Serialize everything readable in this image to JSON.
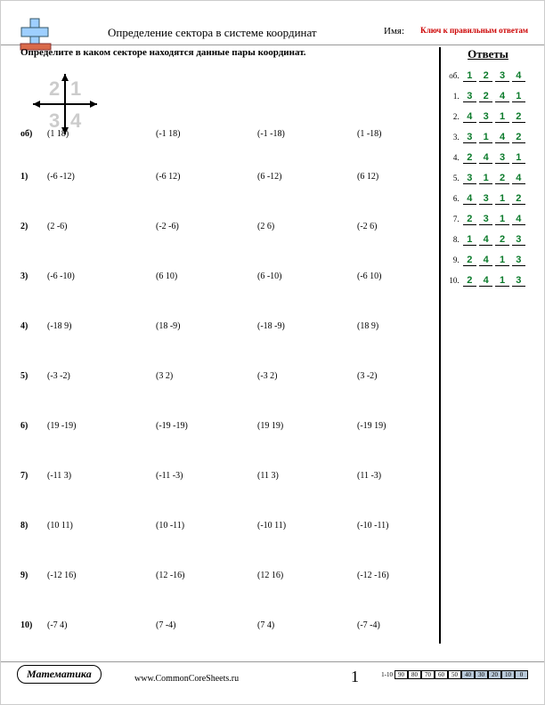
{
  "header": {
    "title": "Определение сектора в системе координат",
    "name_label": "Имя:",
    "key_label": "Ключ к правильным ответам"
  },
  "instruction": "Определите в каком секторе находятся данные пары координат.",
  "quadrants": {
    "q1": "1",
    "q2": "2",
    "q3": "3",
    "q4": "4"
  },
  "rows": [
    {
      "label": "об)",
      "pairs": [
        "(1 18)",
        "(-1 18)",
        "(-1 -18)",
        "(1 -18)"
      ]
    },
    {
      "label": "1)",
      "pairs": [
        "(-6 -12)",
        "(-6 12)",
        "(6 -12)",
        "(6 12)"
      ]
    },
    {
      "label": "2)",
      "pairs": [
        "(2 -6)",
        "(-2 -6)",
        "(2 6)",
        "(-2 6)"
      ]
    },
    {
      "label": "3)",
      "pairs": [
        "(-6 -10)",
        "(6 10)",
        "(6 -10)",
        "(-6 10)"
      ]
    },
    {
      "label": "4)",
      "pairs": [
        "(-18 9)",
        "(18 -9)",
        "(-18 -9)",
        "(18 9)"
      ]
    },
    {
      "label": "5)",
      "pairs": [
        "(-3 -2)",
        "(3 2)",
        "(-3 2)",
        "(3 -2)"
      ]
    },
    {
      "label": "6)",
      "pairs": [
        "(19 -19)",
        "(-19 -19)",
        "(19 19)",
        "(-19 19)"
      ]
    },
    {
      "label": "7)",
      "pairs": [
        "(-11 3)",
        "(-11 -3)",
        "(11 3)",
        "(11 -3)"
      ]
    },
    {
      "label": "8)",
      "pairs": [
        "(10 11)",
        "(10 -11)",
        "(-10 11)",
        "(-10 -11)"
      ]
    },
    {
      "label": "9)",
      "pairs": [
        "(-12 16)",
        "(12 -16)",
        "(12 16)",
        "(-12 -16)"
      ]
    },
    {
      "label": "10)",
      "pairs": [
        "(-7 4)",
        "(7 -4)",
        "(7 4)",
        "(-7 -4)"
      ]
    }
  ],
  "sidebar": {
    "title": "Ответы",
    "rows": [
      {
        "num": "об.",
        "vals": [
          "1",
          "2",
          "3",
          "4"
        ]
      },
      {
        "num": "1.",
        "vals": [
          "3",
          "2",
          "4",
          "1"
        ]
      },
      {
        "num": "2.",
        "vals": [
          "4",
          "3",
          "1",
          "2"
        ]
      },
      {
        "num": "3.",
        "vals": [
          "3",
          "1",
          "4",
          "2"
        ]
      },
      {
        "num": "4.",
        "vals": [
          "2",
          "4",
          "3",
          "1"
        ]
      },
      {
        "num": "5.",
        "vals": [
          "3",
          "1",
          "2",
          "4"
        ]
      },
      {
        "num": "6.",
        "vals": [
          "4",
          "3",
          "1",
          "2"
        ]
      },
      {
        "num": "7.",
        "vals": [
          "2",
          "3",
          "1",
          "4"
        ]
      },
      {
        "num": "8.",
        "vals": [
          "1",
          "4",
          "2",
          "3"
        ]
      },
      {
        "num": "9.",
        "vals": [
          "2",
          "4",
          "1",
          "3"
        ]
      },
      {
        "num": "10.",
        "vals": [
          "2",
          "4",
          "1",
          "3"
        ]
      }
    ]
  },
  "footer": {
    "subject": "Математика",
    "site": "www.CommonCoreSheets.ru",
    "page_number": "1",
    "scale_label": "1-10",
    "scale_cells": [
      "90",
      "80",
      "70",
      "60",
      "50",
      "40",
      "30",
      "20",
      "10",
      "0"
    ]
  }
}
